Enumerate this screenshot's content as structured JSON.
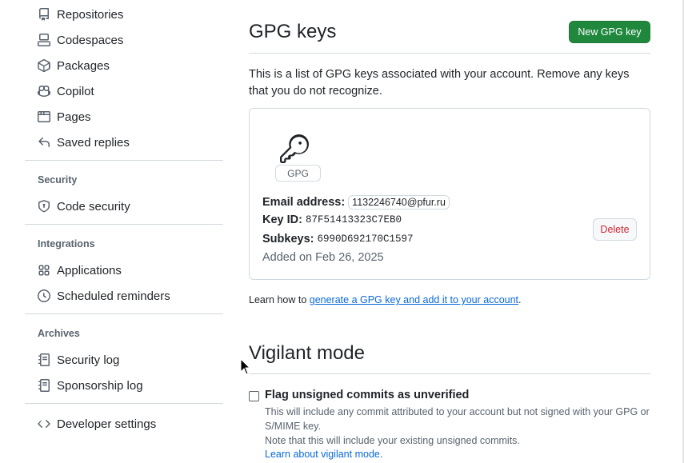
{
  "sidebar": {
    "items": [
      {
        "label": "Repositories",
        "icon": "repo-icon"
      },
      {
        "label": "Codespaces",
        "icon": "codespaces-icon"
      },
      {
        "label": "Packages",
        "icon": "package-icon"
      },
      {
        "label": "Copilot",
        "icon": "copilot-icon"
      },
      {
        "label": "Pages",
        "icon": "browser-icon"
      },
      {
        "label": "Saved replies",
        "icon": "reply-icon"
      }
    ],
    "security_heading": "Security",
    "security_items": [
      {
        "label": "Code security",
        "icon": "shield-lock-icon"
      }
    ],
    "integrations_heading": "Integrations",
    "integrations_items": [
      {
        "label": "Applications",
        "icon": "apps-icon"
      },
      {
        "label": "Scheduled reminders",
        "icon": "clock-icon"
      }
    ],
    "archives_heading": "Archives",
    "archives_items": [
      {
        "label": "Security log",
        "icon": "log-icon"
      },
      {
        "label": "Sponsorship log",
        "icon": "log-icon"
      }
    ],
    "developer_settings": {
      "label": "Developer settings",
      "icon": "code-icon"
    }
  },
  "gpg": {
    "title": "GPG keys",
    "new_button": "New GPG key",
    "description": "This is a list of GPG keys associated with your account. Remove any keys that you do not recognize.",
    "key": {
      "badge": "GPG",
      "email_label": "Email address:",
      "email_value": "1132246740@pfur.ru",
      "key_id_label": "Key ID:",
      "key_id_value": "87F51413323C7EB0",
      "subkeys_label": "Subkeys:",
      "subkeys_value": "6990D692170C1597",
      "added": "Added on Feb 26, 2025",
      "delete_button": "Delete"
    },
    "learn_prefix": "Learn how to ",
    "learn_link": "generate a GPG key and add it to your account",
    "learn_suffix": "."
  },
  "vigilant": {
    "title": "Vigilant mode",
    "checkbox_label": "Flag unsigned commits as unverified",
    "checked": false,
    "note_1": "This will include any commit attributed to your account but not signed with your GPG or S/MIME key.",
    "note_2": "Note that this will include your existing unsigned commits.",
    "learn_link": "Learn about vigilant mode."
  },
  "colors": {
    "primary_button": "#1f883d",
    "link": "#0969da",
    "danger": "#d1242f",
    "muted": "#59636e"
  }
}
